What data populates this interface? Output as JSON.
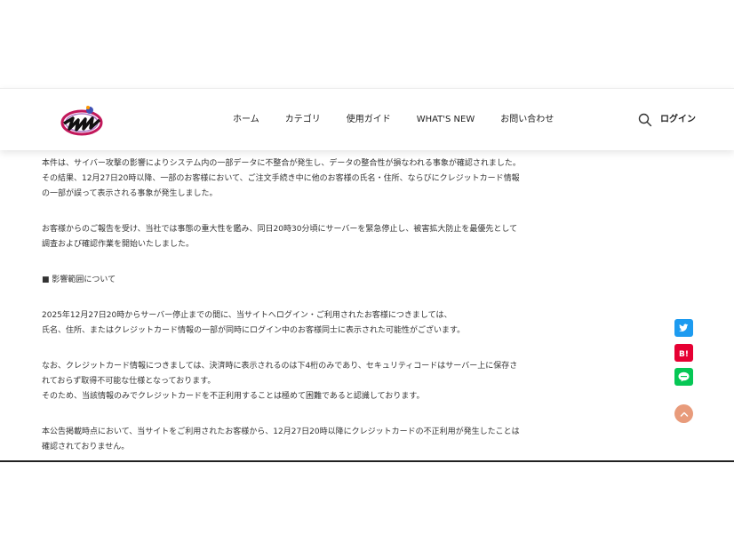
{
  "header": {
    "logo_icon": "site-logo",
    "nav": [
      "ホーム",
      "カテゴリ",
      "使用ガイド",
      "WHAT'S NEW",
      "お問い合わせ"
    ],
    "search_icon": "search-icon",
    "login": "ログイン"
  },
  "article": {
    "paragraphs": [
      [
        "本件は、サイバー攻撃の影響によりシステム内の一部データに不整合が発生し、データの整合性が損なわれる事象が確認されました。",
        "その結果、12月27日20時以降、一部のお客様において、ご注文手続き中に他のお客様の氏名・住所、ならびにクレジットカード情報",
        "の一部が誤って表示される事象が発生しました。"
      ],
      [
        "お客様からのご報告を受け、当社では事態の重大性を鑑み、同日20時30分頃にサーバーを緊急停止し、被害拡大防止を最優先として",
        "調査および確認作業を開始いたしました。"
      ],
      [
        "■ 影響範囲について"
      ],
      [
        "2025年12月27日20時からサーバー停止までの間に、当サイトへログイン・ご利用されたお客様につきましては、",
        "氏名、住所、またはクレジットカード情報の一部が同時にログイン中のお客様同士に表示された可能性がございます。"
      ],
      [
        "なお、クレジットカード情報につきましては、決済時に表示されるのは下4桁のみであり、セキュリティコードはサーバー上に保存さ",
        "れておらず取得不可能な仕様となっております。",
        "そのため、当該情報のみでクレジットカードを不正利用することは極めて困難であると認識しております。"
      ],
      [
        "本公告掲載時点において、当サイトをご利用されたお客様から、12月27日20時以降にクレジットカードの不正利用が発生したことは",
        "確認されておりません。"
      ]
    ]
  },
  "share": {
    "twitter_icon": "twitter-icon",
    "hatena_icon": "hatena-bookmark-icon",
    "line_icon": "line-icon",
    "twitter_color": "#1d9bf0",
    "hatena_color": "#e60033",
    "line_color": "#06c755"
  },
  "back_to_top_icon": "chevron-up-icon",
  "colors": {
    "text": "#333333",
    "back_to_top": "#e89b7b"
  }
}
